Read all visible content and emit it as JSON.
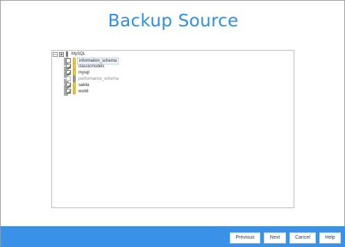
{
  "header": {
    "title": "Backup Source"
  },
  "tree": {
    "root": {
      "label": "MySQL",
      "expander": "⊟"
    },
    "items": [
      {
        "label": "information_schema",
        "checked": false
      },
      {
        "label": "classicmodels",
        "checked": true
      },
      {
        "label": "mysql",
        "checked": true
      },
      {
        "label": "performance_schema",
        "checked": false
      },
      {
        "label": "sakila",
        "checked": true
      },
      {
        "label": "world",
        "checked": true
      }
    ]
  },
  "footer": {
    "previous_label": "Previous",
    "next_label": "Next",
    "cancel_label": "Cancel",
    "help_label": "Help"
  },
  "colors": {
    "title": "#2e8fe6",
    "footer_bar": "#3a92e8",
    "folder": "#f3c93d"
  }
}
